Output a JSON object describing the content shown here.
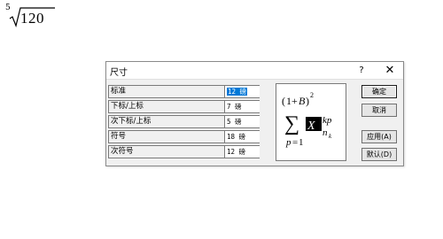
{
  "document": {
    "root_index": "5",
    "radicand": "120"
  },
  "dialog": {
    "title": "尺寸",
    "help_label": "?",
    "close_label": "✕",
    "rows": [
      {
        "label": "标准",
        "value": "12 磅"
      },
      {
        "label": "下标/上标",
        "value": "7 磅"
      },
      {
        "label": "次下标/上标",
        "value": "5 磅"
      },
      {
        "label": "符号",
        "value": "18 磅"
      },
      {
        "label": "次符号",
        "value": "12 磅"
      }
    ],
    "preview": {
      "open_paren": "(",
      "one": "1",
      "plus": "+",
      "b": "B",
      "close_paren": ")",
      "squared": "2",
      "sigma": "∑",
      "p": "p",
      "eq": "=",
      "lower_one": "1",
      "x_box": "X",
      "kp": "kp",
      "n": "n",
      "k": "k"
    },
    "buttons": {
      "ok": "确定",
      "cancel": "取消",
      "apply": "应用(A)",
      "default": "默认(D)"
    }
  }
}
